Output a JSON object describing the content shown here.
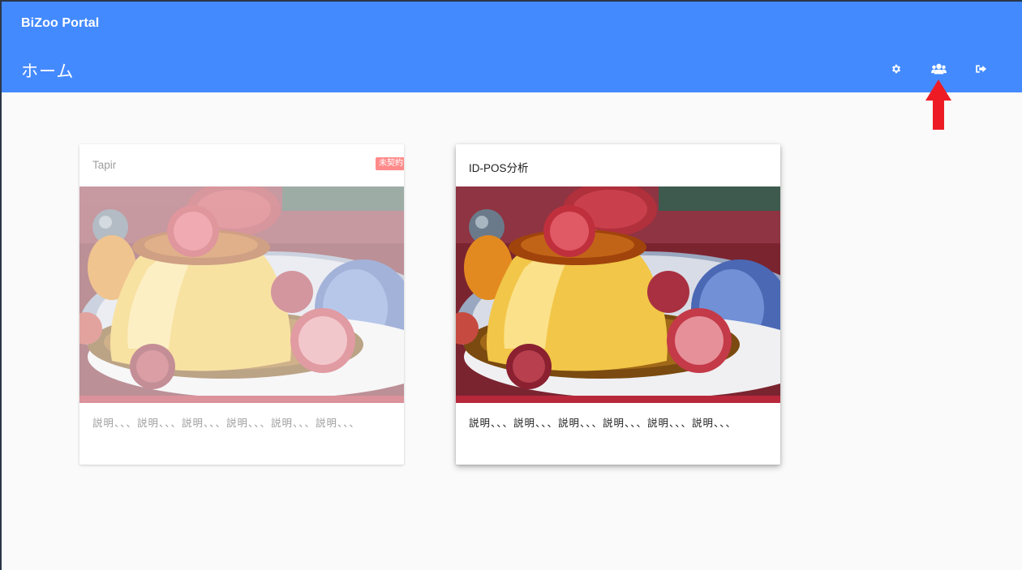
{
  "app": {
    "title": "BiZoo Portal",
    "page_title": "ホーム",
    "brand_color": "#448aff"
  },
  "toolbar": {
    "buttons": [
      {
        "icon": "gear-icon",
        "interactable": true
      },
      {
        "icon": "users-icon",
        "interactable": true
      },
      {
        "icon": "logout-icon",
        "interactable": true
      }
    ]
  },
  "annotation": {
    "icon": "red-arrow-up",
    "color": "#ed1c24"
  },
  "cards": [
    {
      "title": "Tapir",
      "badge": "未契約",
      "badge_color": "#ff8a8a",
      "image": "custard-pudding-with-raspberries",
      "description": "説明、、、説明、、、説明、、、説明、、、説明、、、説明、、、",
      "state": "disabled"
    },
    {
      "title": "ID-POS分析",
      "image": "custard-pudding-with-raspberries",
      "description": "説明、、、説明、、、説明、、、説明、、、説明、、、説明、、、",
      "state": "active"
    }
  ]
}
